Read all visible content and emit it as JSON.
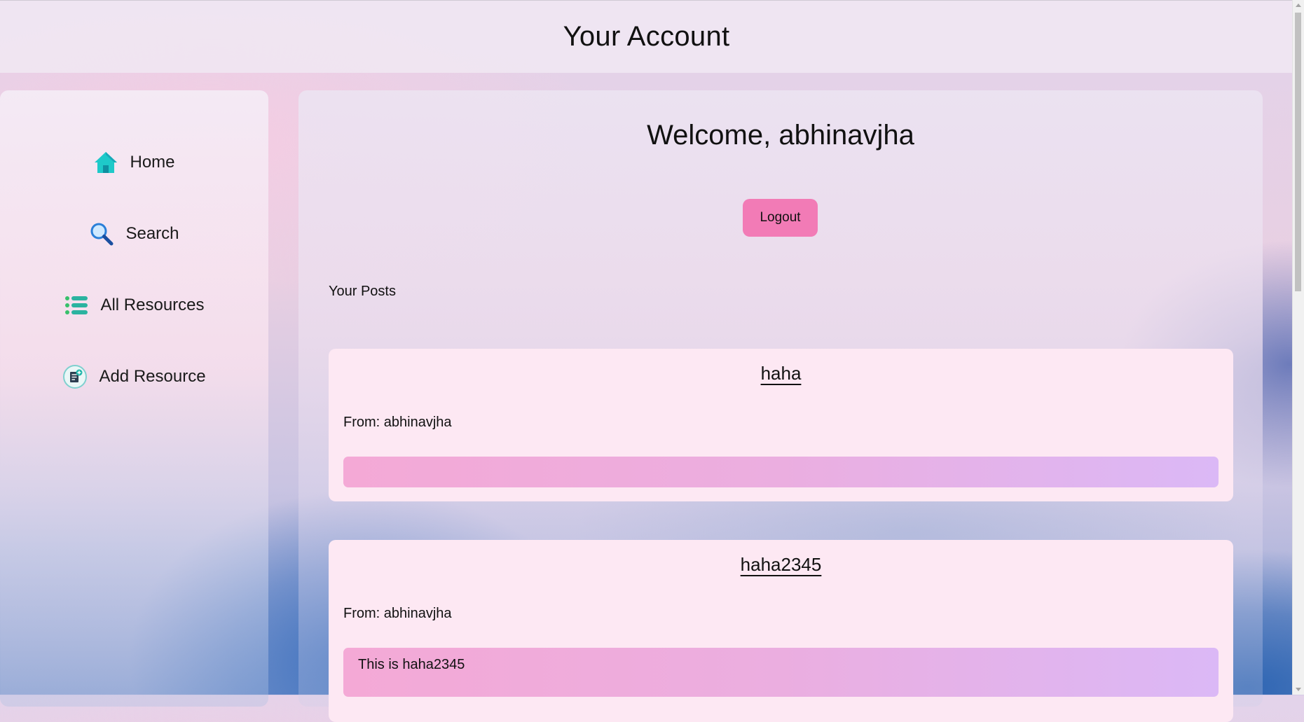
{
  "header": {
    "title": "Your Account"
  },
  "sidebar": {
    "items": [
      {
        "label": "Home",
        "icon": "home-icon"
      },
      {
        "label": "Search",
        "icon": "search-icon"
      },
      {
        "label": "All Resources",
        "icon": "list-icon"
      },
      {
        "label": "Add Resource",
        "icon": "add-document-icon"
      }
    ]
  },
  "main": {
    "welcome": "Welcome, abhinavjha",
    "logout_label": "Logout",
    "posts_heading": "Your Posts",
    "posts": [
      {
        "title": "haha",
        "from": "From: abhinavjha",
        "body": ""
      },
      {
        "title": "haha2345",
        "from": "From: abhinavjha",
        "body": "This is haha2345"
      }
    ]
  },
  "colors": {
    "accent_button": "#f27bb6",
    "card_background": "#fde8f3",
    "body_gradient_start": "#f4a9d6",
    "body_gradient_end": "#dbb8f6"
  }
}
